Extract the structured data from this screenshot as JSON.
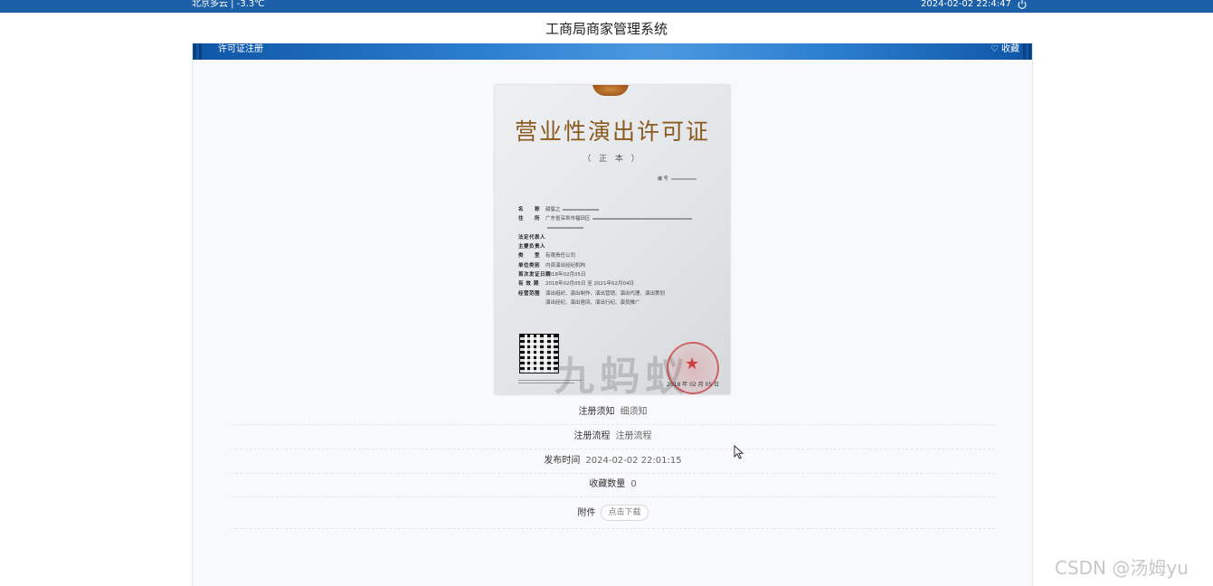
{
  "topbar": {
    "weather": "北京多云 | -3.3℃",
    "datetime": "2024-02-02  22:4:47",
    "bg_color": "#1b5fa8"
  },
  "site_title": "工商局商家管理系统",
  "panel": {
    "title": "许可证注册",
    "favorite_label": "收藏",
    "favorite_icon": "heart-outline-icon",
    "header_color": "#1561b0"
  },
  "license_image": {
    "title": "营业性演出许可证",
    "subtitle": "（ 正 本 ）",
    "number_label": "编 号",
    "fields": [
      {
        "label": "名　　称",
        "value": "甜蜜之"
      },
      {
        "label": "住　　所",
        "value": "广东省深圳市福田区"
      },
      {
        "label": "",
        "value": ""
      },
      {
        "label": "法定代表人",
        "value": ""
      },
      {
        "label": "主要负责人",
        "value": ""
      },
      {
        "label": "类　　型",
        "value": "有限责任公司"
      },
      {
        "label": "单位类别",
        "value": "内资演出经纪机构"
      },
      {
        "label": "首次发证日期",
        "value": "2018年02月05日"
      },
      {
        "label": "有 效 期",
        "value": "2018年02月05日 至 2021年02月04日"
      },
      {
        "label": "经营范围",
        "value": "演出组织、演出制作、演出营销、演出代理、演出策划"
      },
      {
        "label": "",
        "value": "演出经纪、演出居间、演出行纪、演员推广"
      }
    ],
    "watermark": "九蚂蚁",
    "date": "2018 年 02 月 05 日"
  },
  "info": {
    "notice_label": "注册须知",
    "notice_value": "细须知",
    "process_label": "注册流程",
    "process_value": "注册流程",
    "publish_label": "发布时间",
    "publish_value": "2024-02-02 22:01:15",
    "fav_count_label": "收藏数量",
    "fav_count_value": "0",
    "attachment_label": "附件",
    "download_label": "点击下载"
  },
  "watermark_text": "CSDN @汤姆yu"
}
